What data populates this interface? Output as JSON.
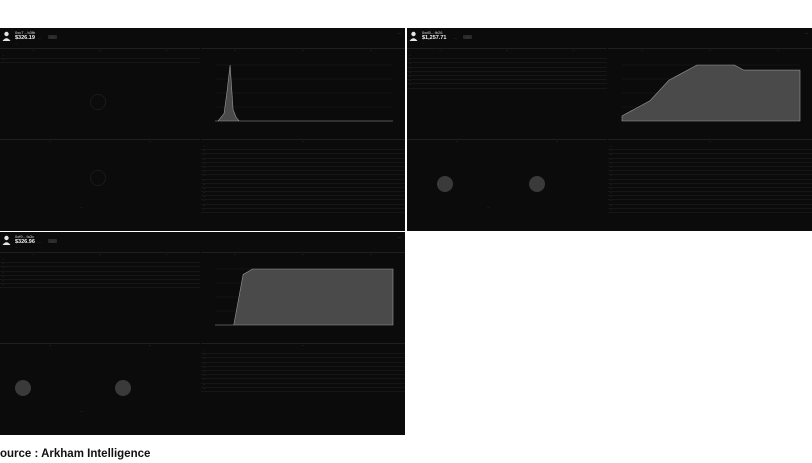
{
  "source": {
    "label": "ource : Arkham Intelligence"
  },
  "panels": [
    {
      "address": "0xc7…b3fb",
      "balance": "$326.19",
      "change": "…",
      "badge": "…",
      "tags": "…",
      "controls": "…",
      "tabs": {
        "portfolio": [
          "…",
          "…",
          "…"
        ],
        "history": [
          "…",
          "…",
          "…"
        ],
        "exchanges": [
          "…",
          "…"
        ],
        "transfers_head": "…",
        "counterparties": "…"
      },
      "chart": {
        "type": "area",
        "x": [
          0,
          1,
          2,
          3,
          4,
          5,
          6,
          7,
          8,
          9,
          10,
          11,
          12,
          13,
          14,
          15,
          16,
          17,
          18,
          19,
          20,
          21,
          22,
          23,
          24,
          25,
          26,
          27,
          28,
          29,
          30,
          31,
          32,
          33,
          34,
          35,
          36,
          37,
          38,
          39,
          40,
          41,
          42,
          43,
          44,
          45,
          46,
          47,
          48,
          49,
          50,
          51,
          52,
          53,
          54,
          55,
          56,
          57,
          58,
          59
        ],
        "values": [
          0,
          0,
          1,
          2,
          8,
          15,
          3,
          1,
          0,
          0,
          0,
          0,
          0,
          0,
          0,
          0,
          0,
          0,
          0,
          0,
          0,
          0,
          0,
          0,
          0,
          0,
          0,
          0,
          0,
          0,
          0,
          0,
          0,
          0,
          0,
          0,
          0,
          0,
          0,
          0,
          0,
          0,
          0,
          0,
          0,
          0,
          0,
          0,
          0,
          0,
          0,
          0,
          0,
          0,
          0,
          0,
          0,
          0,
          0,
          0
        ]
      },
      "transfer_rows": 16,
      "portfolio_rows": 2
    },
    {
      "address": "0xd5…fb26",
      "balance": "$1,257.71",
      "change": "…",
      "badge": "…",
      "tags": "…",
      "controls": "…",
      "tabs": {
        "portfolio": [
          "…",
          "…",
          "…"
        ],
        "history": [
          "…",
          "…",
          "…"
        ],
        "exchanges": [
          "…",
          "…"
        ],
        "transfers_head": "…",
        "counterparties": "…"
      },
      "chart": {
        "type": "area",
        "x": [
          0,
          1,
          2,
          3,
          4,
          5,
          6,
          7,
          8,
          9,
          10,
          11,
          12,
          13,
          14,
          15,
          16,
          17,
          18,
          19
        ],
        "values": [
          1,
          2,
          3,
          4,
          6,
          8,
          9,
          10,
          11,
          11,
          11,
          11,
          11,
          10,
          10,
          10,
          10,
          10,
          10,
          10
        ]
      },
      "transfer_rows": 16,
      "portfolio_rows": 8
    },
    {
      "address": "0xf9…fa3c",
      "balance": "$326.96",
      "change": "…",
      "badge": "…",
      "tags": "…",
      "controls": "…",
      "tabs": {
        "portfolio": [
          "…",
          "…",
          "…"
        ],
        "history": [
          "…",
          "…",
          "…"
        ],
        "exchanges": [
          "…",
          "…"
        ],
        "transfers_head": "…",
        "counterparties": "…"
      },
      "chart": {
        "type": "area",
        "x": [
          0,
          1,
          2,
          3,
          4,
          5,
          6,
          7,
          8,
          9,
          10,
          11,
          12,
          13,
          14,
          15,
          16,
          17,
          18,
          19
        ],
        "values": [
          0,
          0,
          0,
          9,
          10,
          10,
          10,
          10,
          10,
          10,
          10,
          10,
          10,
          10,
          10,
          10,
          10,
          10,
          10,
          10
        ]
      },
      "transfer_rows": 10,
      "portfolio_rows": 7
    }
  ]
}
